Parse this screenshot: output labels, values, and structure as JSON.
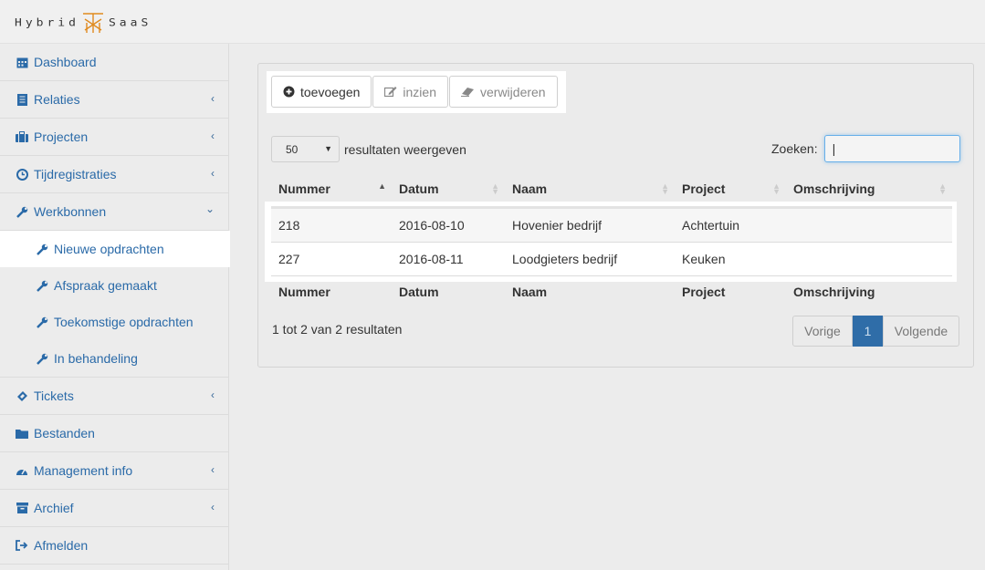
{
  "brand": {
    "left": "Hybrid",
    "right": "SaaS",
    "accent": "#e08a1e"
  },
  "sidebar": {
    "items": [
      {
        "label": "Dashboard",
        "icon": "calendar-icon",
        "chevron": false
      },
      {
        "label": "Relaties",
        "icon": "book-icon",
        "chevron": true
      },
      {
        "label": "Projecten",
        "icon": "briefcase-icon",
        "chevron": true
      },
      {
        "label": "Tijdregistraties",
        "icon": "clock-icon",
        "chevron": true
      },
      {
        "label": "Werkbonnen",
        "icon": "wrench-icon",
        "chevron": "down"
      },
      {
        "label": "Tickets",
        "icon": "ticket-icon",
        "chevron": true
      },
      {
        "label": "Bestanden",
        "icon": "folder-icon",
        "chevron": false
      },
      {
        "label": "Management info",
        "icon": "dashboard-icon",
        "chevron": true
      },
      {
        "label": "Archief",
        "icon": "archive-icon",
        "chevron": true
      },
      {
        "label": "Afmelden",
        "icon": "sign-out-icon",
        "chevron": false
      }
    ],
    "sub_items": [
      {
        "label": "Nieuwe opdrachten",
        "active": true
      },
      {
        "label": "Afspraak gemaakt",
        "active": false
      },
      {
        "label": "Toekomstige opdrachten",
        "active": false
      },
      {
        "label": "In behandeling",
        "active": false
      }
    ]
  },
  "toolbar": {
    "add_label": "toevoegen",
    "view_label": "inzien",
    "delete_label": "verwijderen"
  },
  "table": {
    "length_value": "50",
    "length_label": "resultaten weergeven",
    "search_label": "Zoeken:",
    "search_value": "|",
    "columns": [
      "Nummer",
      "Datum",
      "Naam",
      "Project",
      "Omschrijving"
    ],
    "rows": [
      [
        "218",
        "2016-08-10",
        "Hovenier bedrijf",
        "Achtertuin",
        ""
      ],
      [
        "227",
        "2016-08-11",
        "Loodgieters bedrijf",
        "Keuken",
        ""
      ]
    ],
    "info": "1 tot 2 van 2 resultaten",
    "pager": {
      "prev": "Vorige",
      "current": "1",
      "next": "Volgende"
    }
  },
  "colors": {
    "link": "#2a6aa8",
    "pager_active": "#2f6da8",
    "focus": "#66afe9"
  }
}
